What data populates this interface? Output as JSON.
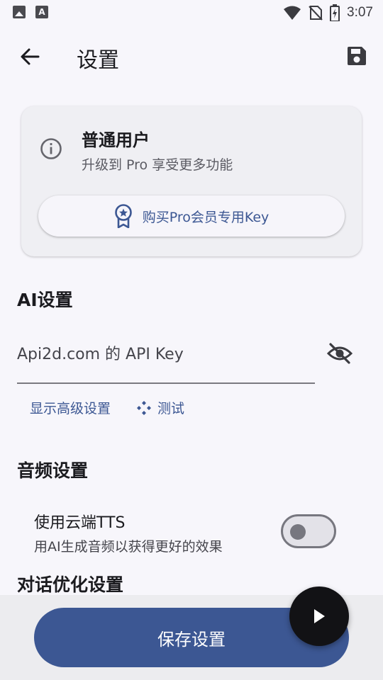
{
  "status_bar": {
    "time": "3:07",
    "left_icons": [
      "image-icon",
      "font-icon"
    ],
    "right_icons": [
      "wifi-icon",
      "no-sim-icon",
      "battery-charging-icon"
    ]
  },
  "app_bar": {
    "title": "设置",
    "back_icon": "arrow-left-icon",
    "save_icon": "floppy-disk-icon"
  },
  "user_card": {
    "user_type": "普通用户",
    "upgrade_hint": "升级到 Pro 享受更多功能",
    "buy_button_label": "购买Pro会员专用Key"
  },
  "ai_settings": {
    "title": "AI设置",
    "api_key_placeholder": "Api2d.com 的 API Key",
    "api_key_value": "",
    "show_advanced_label": "显示高级设置",
    "test_label": "测试"
  },
  "audio_settings": {
    "title": "音频设置",
    "tts_label": "使用云端TTS",
    "tts_subtitle": "用AI生成音频以获得更好的效果",
    "tts_enabled": false
  },
  "dialog_settings": {
    "title": "对话优化设置"
  },
  "bottom": {
    "save_button_label": "保存设置",
    "fab_icon": "play-icon"
  },
  "colors": {
    "primary": "#3c5793",
    "background": "#f7f6fb",
    "fab": "#121215"
  }
}
